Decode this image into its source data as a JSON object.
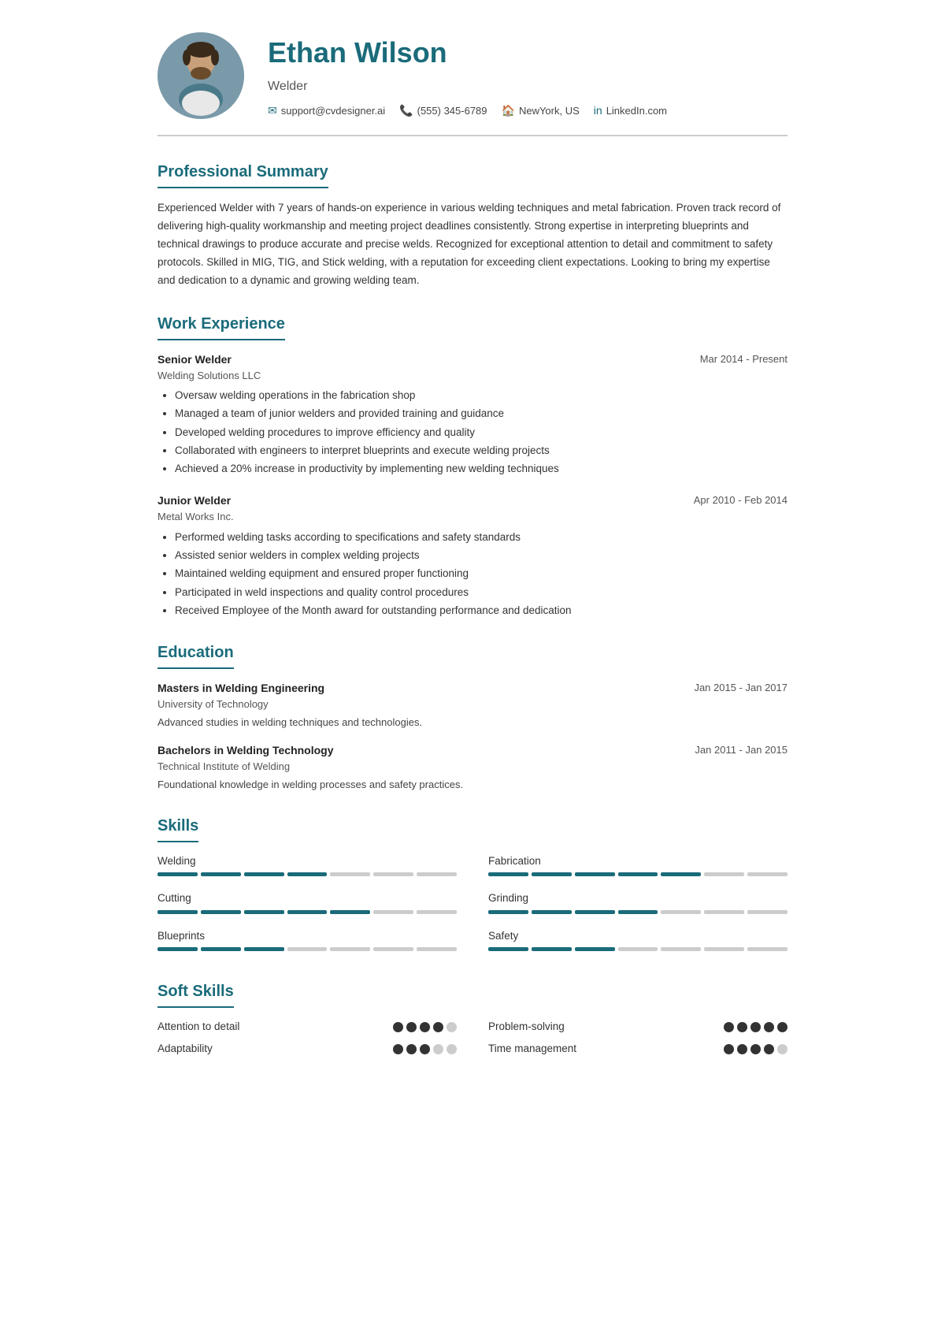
{
  "header": {
    "name": "Ethan Wilson",
    "title": "Welder",
    "email": "support@cvdesigner.ai",
    "phone": "(555) 345-6789",
    "location": "NewYork, US",
    "linkedin": "LinkedIn.com"
  },
  "summary": {
    "section_title": "Professional Summary",
    "text": "Experienced Welder with 7 years of hands-on experience in various welding techniques and metal fabrication. Proven track record of delivering high-quality workmanship and meeting project deadlines consistently. Strong expertise in interpreting blueprints and technical drawings to produce accurate and precise welds. Recognized for exceptional attention to detail and commitment to safety protocols. Skilled in MIG, TIG, and Stick welding, with a reputation for exceeding client expectations. Looking to bring my expertise and dedication to a dynamic and growing welding team."
  },
  "work_experience": {
    "section_title": "Work Experience",
    "jobs": [
      {
        "title": "Senior Welder",
        "company": "Welding Solutions LLC",
        "date": "Mar 2014 - Present",
        "bullets": [
          "Oversaw welding operations in the fabrication shop",
          "Managed a team of junior welders and provided training and guidance",
          "Developed welding procedures to improve efficiency and quality",
          "Collaborated with engineers to interpret blueprints and execute welding projects",
          "Achieved a 20% increase in productivity by implementing new welding techniques"
        ]
      },
      {
        "title": "Junior Welder",
        "company": "Metal Works Inc.",
        "date": "Apr 2010 - Feb 2014",
        "bullets": [
          "Performed welding tasks according to specifications and safety standards",
          "Assisted senior welders in complex welding projects",
          "Maintained welding equipment and ensured proper functioning",
          "Participated in weld inspections and quality control procedures",
          "Received Employee of the Month award for outstanding performance and dedication"
        ]
      }
    ]
  },
  "education": {
    "section_title": "Education",
    "items": [
      {
        "degree": "Masters in Welding Engineering",
        "school": "University of Technology",
        "date": "Jan 2015 - Jan 2017",
        "desc": "Advanced studies in welding techniques and technologies."
      },
      {
        "degree": "Bachelors in Welding Technology",
        "school": "Technical Institute of Welding",
        "date": "Jan 2011 - Jan 2015",
        "desc": "Foundational knowledge in welding processes and safety practices."
      }
    ]
  },
  "skills": {
    "section_title": "Skills",
    "items": [
      {
        "label": "Welding",
        "filled": 4,
        "total": 7
      },
      {
        "label": "Fabrication",
        "filled": 5,
        "total": 7
      },
      {
        "label": "Cutting",
        "filled": 5,
        "total": 7
      },
      {
        "label": "Grinding",
        "filled": 4,
        "total": 7
      },
      {
        "label": "Blueprints",
        "filled": 3,
        "total": 7
      },
      {
        "label": "Safety",
        "filled": 3,
        "total": 7
      }
    ]
  },
  "soft_skills": {
    "section_title": "Soft Skills",
    "items": [
      {
        "label": "Attention to detail",
        "filled": 4,
        "total": 5,
        "col": 0
      },
      {
        "label": "Problem-solving",
        "filled": 5,
        "total": 5,
        "col": 1
      },
      {
        "label": "Adaptability",
        "filled": 3,
        "total": 5,
        "col": 0
      },
      {
        "label": "Time management",
        "filled": 4,
        "total": 5,
        "col": 1
      }
    ]
  }
}
